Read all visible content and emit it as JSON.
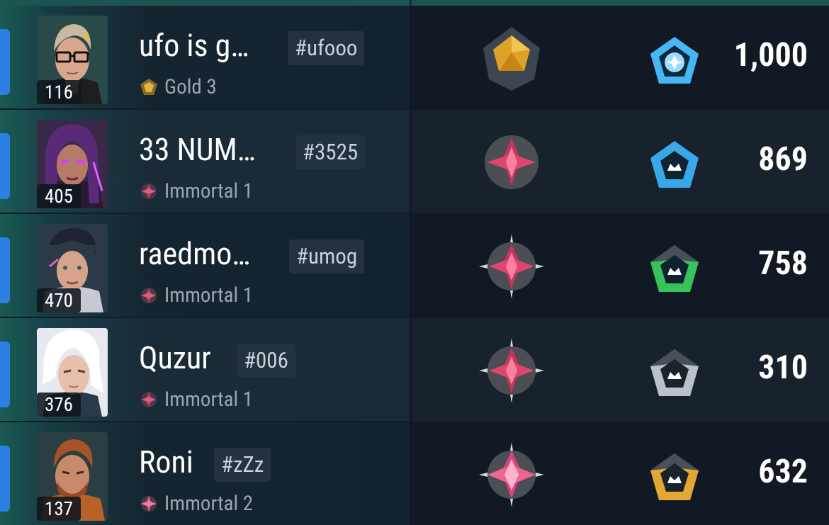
{
  "players": [
    {
      "level": "116",
      "name": "ufo is g…",
      "tag": "#ufooo",
      "rank": "Gold 3",
      "rank_icon": "gold-rank-icon",
      "score": "1,000",
      "tier_color": "#46b6f4"
    },
    {
      "level": "405",
      "name": "33 NUM…",
      "tag": "#3525",
      "rank": "Immortal 1",
      "rank_icon": "immortal-rank-icon",
      "score": "869",
      "tier_color": "#39a8e8"
    },
    {
      "level": "470",
      "name": "raedmo…",
      "tag": "#umog",
      "rank": "Immortal 1",
      "rank_icon": "immortal-rank-icon",
      "score": "758",
      "tier_color": "#35c35a"
    },
    {
      "level": "376",
      "name": "Quzur",
      "tag": "#006",
      "rank": "Immortal 1",
      "rank_icon": "immortal-rank-icon",
      "score": "310",
      "tier_color": "#b8c2c8"
    },
    {
      "level": "137",
      "name": "Roni",
      "tag": "#zZz",
      "rank": "Immortal 2",
      "rank_icon": "immortal-rank-icon",
      "score": "632",
      "tier_color": "#e3a733"
    }
  ]
}
